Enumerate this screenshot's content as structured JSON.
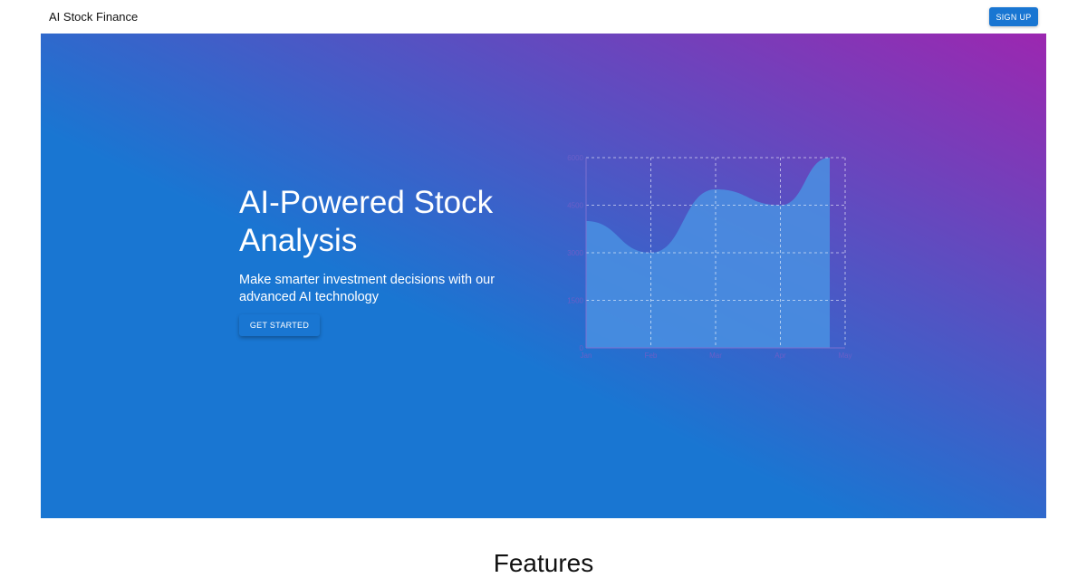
{
  "appbar": {
    "brand": "AI Stock Finance",
    "signup_label": "SIGN UP"
  },
  "hero": {
    "title": "AI-Powered Stock Analysis",
    "subtitle": "Make smarter investment decisions with our advanced AI technology",
    "cta_label": "GET STARTED",
    "gradient_start": "#1976d2",
    "gradient_end": "#9c27b0"
  },
  "chart_data": {
    "type": "area",
    "categories": [
      "Jan",
      "Feb",
      "Mar",
      "Apr",
      "May"
    ],
    "values": [
      4000,
      3000,
      5000,
      4500,
      6000
    ],
    "y_ticks": [
      "0",
      "1500",
      "3000",
      "4500",
      "6000"
    ],
    "ylim": [
      0,
      6000
    ],
    "grid": true,
    "fill_color": "#4a90e2",
    "title": "",
    "xlabel": "",
    "ylabel": ""
  },
  "features": {
    "title": "Features"
  }
}
